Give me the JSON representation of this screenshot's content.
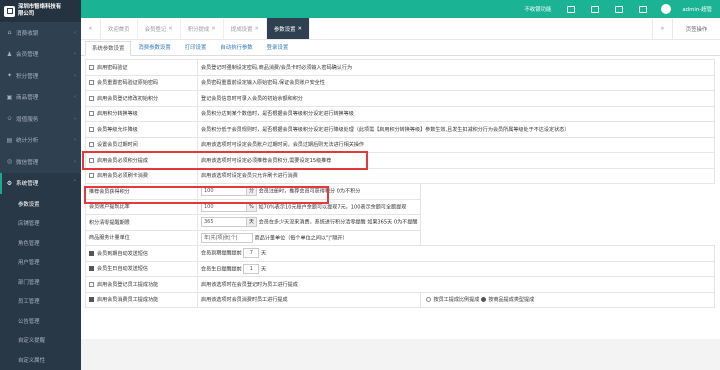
{
  "brand": {
    "name_line1": "深圳市智络科技有",
    "name_line2": "限公司"
  },
  "sidebar": {
    "items": [
      {
        "label": "消费收银",
        "icon": "cart-icon"
      },
      {
        "label": "会员管理",
        "icon": "user-icon"
      },
      {
        "label": "积分管理",
        "icon": "gift-icon"
      },
      {
        "label": "商品管理",
        "icon": "box-icon"
      },
      {
        "label": "增值服务",
        "icon": "star-icon"
      },
      {
        "label": "统计分析",
        "icon": "chart-icon"
      },
      {
        "label": "微信管理",
        "icon": "wechat-icon"
      },
      {
        "label": "系统管理",
        "icon": "gear-icon"
      }
    ],
    "sub_items": [
      "参数设置",
      "店铺管理",
      "角色管理",
      "用户管理",
      "部门管理",
      "员工管理",
      "公告管理",
      "自定义提醒",
      "自定义属性"
    ]
  },
  "topbar": {
    "quick": "不收银功能",
    "user": "admin-超管"
  },
  "tabs": [
    {
      "label": "欢迎首页",
      "closable": false
    },
    {
      "label": "会员登记",
      "closable": true
    },
    {
      "label": "积分提成",
      "closable": true
    },
    {
      "label": "提成设置",
      "closable": true
    },
    {
      "label": "参数设置",
      "closable": true,
      "active": true
    }
  ],
  "page_op": "页签操作",
  "subtabs": [
    "系统参数设置",
    "消费参数设置",
    "打印设置",
    "自动执行参数",
    "登录设置"
  ],
  "rows": [
    {
      "type": "check",
      "checked": false,
      "label": "启用密码验证",
      "desc": "会员登记时强制设定密码,商品消费/会员卡时必须输入密码确认行为"
    },
    {
      "type": "check",
      "checked": false,
      "label": "会员重置密码验证原始密码",
      "desc": "会员密码重置前设定输入原始密码,保证会员账户安全性"
    },
    {
      "type": "check",
      "checked": false,
      "label": "启用会员登记修改初始积分",
      "desc": "登记会员信息时可录入会员的初始余额和积分"
    },
    {
      "type": "check",
      "checked": false,
      "label": "启用积分转换等级",
      "desc": "会员积分达到某个数值时，是否根据会员等级积分设定进行转换等级"
    },
    {
      "type": "check",
      "checked": false,
      "label": "会员等级允许降级",
      "desc": "会员积分低于会员规则时，是否根据会员等级积分设定进行降级处理（此项需【启用积分转换等级】参数生效,且发生扣减积分行为会员所属等级处于不达设定状态）"
    },
    {
      "type": "check",
      "checked": false,
      "label": "设置会员过期时间",
      "desc": "启用该选项时可设定会员账户过期时间，会员过期后则无法进行相关操作"
    },
    {
      "type": "check",
      "checked": false,
      "label": "启用会员必须积分提成",
      "desc": "启用该选项时可设定必须推荐会员积分,需要设定15级推荐"
    },
    {
      "type": "check",
      "checked": false,
      "label": "启用会员必须刷卡消费",
      "desc": "启用该选项时设定会员只允许刷卡进行消费"
    },
    {
      "type": "input",
      "label": "推荐会员获得积分",
      "value": "100",
      "unit": "分",
      "desc": "会员注册时，推荐会员可获得积分 0为不积分"
    },
    {
      "type": "input",
      "label": "会员账户提现比率",
      "value": "100",
      "unit": "%",
      "desc": "如70%表示10元账户余额可以提现7元，100表示余额可全额提现"
    },
    {
      "type": "input",
      "label": "积分清零提醒期限",
      "value": "365",
      "unit": "天",
      "desc": "会员在多少天没来消费，系统进行积分清零提醒 如果365天 0为不提醒"
    },
    {
      "type": "input",
      "label": "商品服务计量单位",
      "value": "年|先|项|张|个|",
      "unit": "",
      "desc": "商品计量单位（每个单位之间以\"|\"隔开）"
    },
    {
      "type": "check-inline",
      "checked": true,
      "label": "会员到期自动发送短信",
      "desc": "会员到期提醒提前",
      "value": "7",
      "unit": "天"
    },
    {
      "type": "check-inline",
      "checked": true,
      "label": "会员生日自动发送短信",
      "desc": "会员生日提醒提前",
      "value": "1",
      "unit": "天"
    },
    {
      "type": "check",
      "checked": false,
      "label": "启用会员登记员工提成功能",
      "desc": "启用该选项时在会员登记时为员工进行提成"
    },
    {
      "type": "radio",
      "checked": true,
      "label": "启用会员消费员工提成功能",
      "desc": "启用该选项时会员消费时员工进行提成",
      "opt1": "按员工提成比例提成",
      "opt2": "按商品提成类型提成"
    }
  ]
}
